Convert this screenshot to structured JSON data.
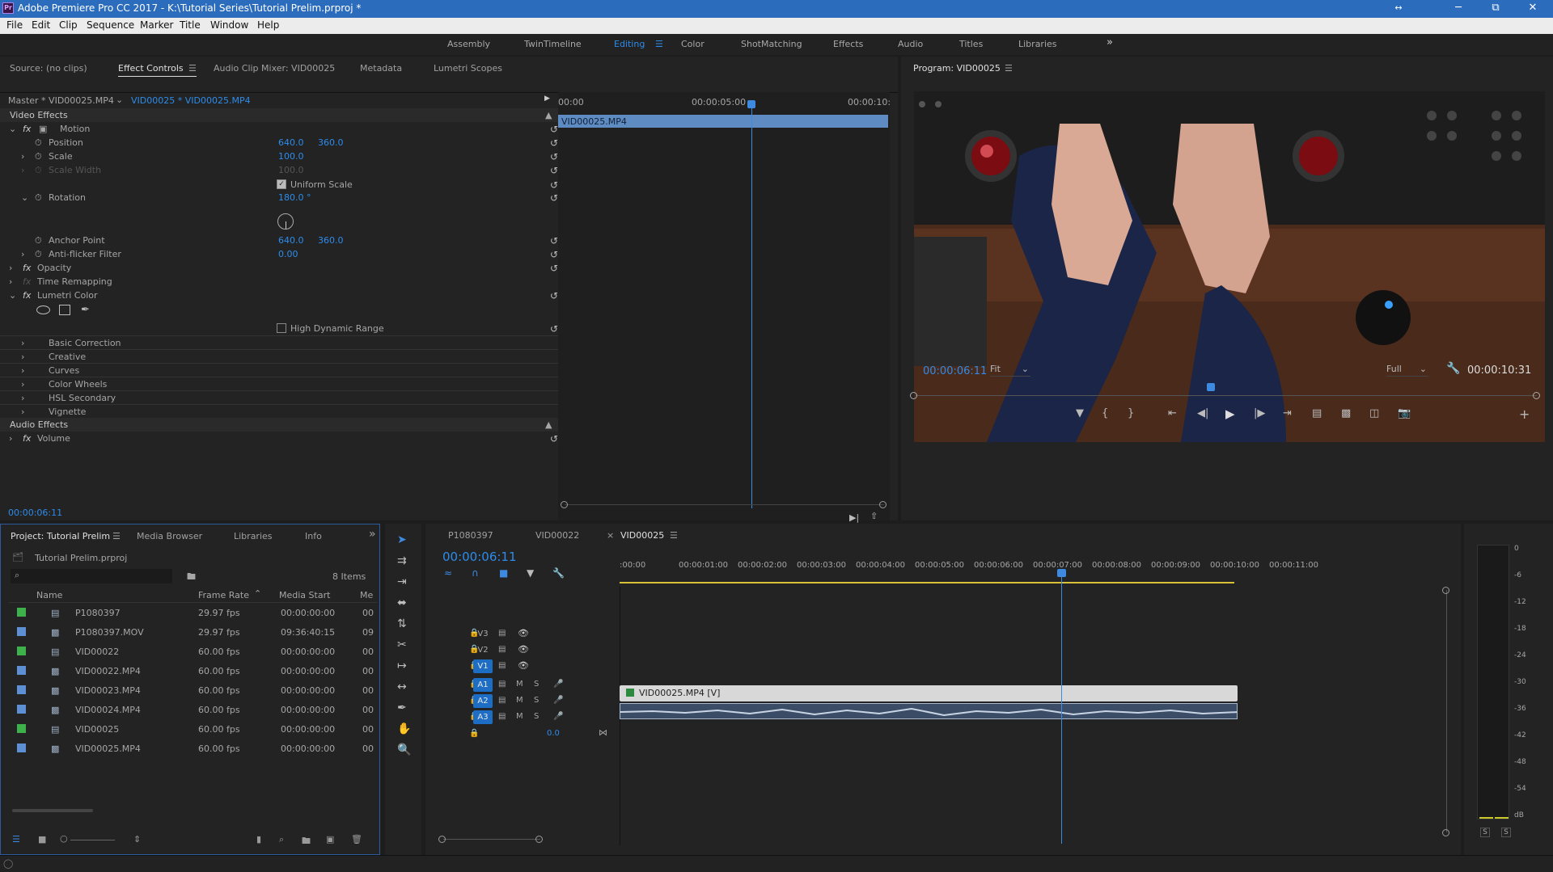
{
  "app": {
    "title": "Adobe Premiere Pro CC 2017 - K:\\Tutorial Series\\Tutorial Prelim.prproj *",
    "icon": "Pr"
  },
  "window_controls": {
    "minimize": "─",
    "restore": "⧉",
    "close": "✕",
    "arrows": "↔"
  },
  "menu": [
    "File",
    "Edit",
    "Clip",
    "Sequence",
    "Marker",
    "Title",
    "Window",
    "Help"
  ],
  "workspaces": {
    "items": [
      "Assembly",
      "TwinTimeline",
      "Editing",
      "Color",
      "ShotMatching",
      "Effects",
      "Audio",
      "Titles",
      "Libraries"
    ],
    "active": "Editing",
    "more": "»"
  },
  "source_panel": {
    "tabs": [
      "Source: (no clips)",
      "Effect Controls",
      "Audio Clip Mixer: VID00025",
      "Metadata",
      "Lumetri Scopes"
    ],
    "active": "Effect Controls",
    "master": "Master * VID00025.MP4",
    "clip": "VID00025 * VID00025.MP4",
    "ruler": [
      "00:00",
      "00:00:05:00",
      "00:00:10:"
    ],
    "clip_bar": "VID00025.MP4",
    "video_effects": "Video Effects",
    "audio_effects": "Audio Effects",
    "motion": "Motion",
    "position": {
      "label": "Position",
      "x": "640.0",
      "y": "360.0"
    },
    "scale": {
      "label": "Scale",
      "v": "100.0"
    },
    "scale_width": {
      "label": "Scale Width",
      "v": "100.0"
    },
    "uniform_scale": "Uniform Scale",
    "rotation": {
      "label": "Rotation",
      "v": "180.0 °"
    },
    "anchor": {
      "label": "Anchor Point",
      "x": "640.0",
      "y": "360.0"
    },
    "antiflicker": {
      "label": "Anti-flicker Filter",
      "v": "0.00"
    },
    "opacity": "Opacity",
    "time_remap": "Time Remapping",
    "lumetri": "Lumetri Color",
    "hdr": "High Dynamic Range",
    "lumetri_items": [
      "Basic Correction",
      "Creative",
      "Curves",
      "Color Wheels",
      "HSL Secondary",
      "Vignette"
    ],
    "volume": "Volume",
    "timecode": "00:00:06:11"
  },
  "program": {
    "title": "Program: VID00025",
    "timecode": "00:00:06:11",
    "fit": "Fit",
    "quality": "Full",
    "duration": "00:00:10:31"
  },
  "project": {
    "tabs": [
      "Project: Tutorial Prelim",
      "Media Browser",
      "Libraries",
      "Info"
    ],
    "file": "Tutorial Prelim.prproj",
    "count": "8 Items",
    "columns": [
      "Name",
      "Frame Rate",
      "Media Start",
      "Me"
    ],
    "rows": [
      {
        "name": "P1080397",
        "rate": "29.97 fps",
        "start": "00:00:00:00",
        "me": "00",
        "color": "#3fb14a",
        "kind": "seq"
      },
      {
        "name": "P1080397.MOV",
        "rate": "29.97 fps",
        "start": "09:36:40:15",
        "me": "09",
        "color": "#5d8fd4",
        "kind": "clip"
      },
      {
        "name": "VID00022",
        "rate": "60.00 fps",
        "start": "00:00:00:00",
        "me": "00",
        "color": "#3fb14a",
        "kind": "seq"
      },
      {
        "name": "VID00022.MP4",
        "rate": "60.00 fps",
        "start": "00:00:00:00",
        "me": "00",
        "color": "#5d8fd4",
        "kind": "clip"
      },
      {
        "name": "VID00023.MP4",
        "rate": "60.00 fps",
        "start": "00:00:00:00",
        "me": "00",
        "color": "#5d8fd4",
        "kind": "clip"
      },
      {
        "name": "VID00024.MP4",
        "rate": "60.00 fps",
        "start": "00:00:00:00",
        "me": "00",
        "color": "#5d8fd4",
        "kind": "clip"
      },
      {
        "name": "VID00025",
        "rate": "60.00 fps",
        "start": "00:00:00:00",
        "me": "00",
        "color": "#3fb14a",
        "kind": "seq"
      },
      {
        "name": "VID00025.MP4",
        "rate": "60.00 fps",
        "start": "00:00:00:00",
        "me": "00",
        "color": "#5d8fd4",
        "kind": "clip"
      }
    ]
  },
  "timeline": {
    "tabs": [
      "P1080397",
      "VID00022",
      "VID00025"
    ],
    "active": "VID00025",
    "timecode": "00:00:06:11",
    "ruler": [
      ":00:00",
      "00:00:01:00",
      "00:00:02:00",
      "00:00:03:00",
      "00:00:04:00",
      "00:00:05:00",
      "00:00:06:00",
      "00:00:07:00",
      "00:00:08:00",
      "00:00:09:00",
      "00:00:10:00",
      "00:00:11:00"
    ],
    "video_tracks": [
      "V3",
      "V2",
      "V1"
    ],
    "audio_tracks": [
      "A1",
      "A2",
      "A3"
    ],
    "master_vol": "0.0",
    "clip_label": "VID00025.MP4 [V]"
  },
  "meter": {
    "scale": [
      "0",
      "-6",
      "-12",
      "-18",
      "-24",
      "-30",
      "-36",
      "-42",
      "-48",
      "-54",
      "dB"
    ],
    "solo": [
      "S",
      "S"
    ]
  }
}
